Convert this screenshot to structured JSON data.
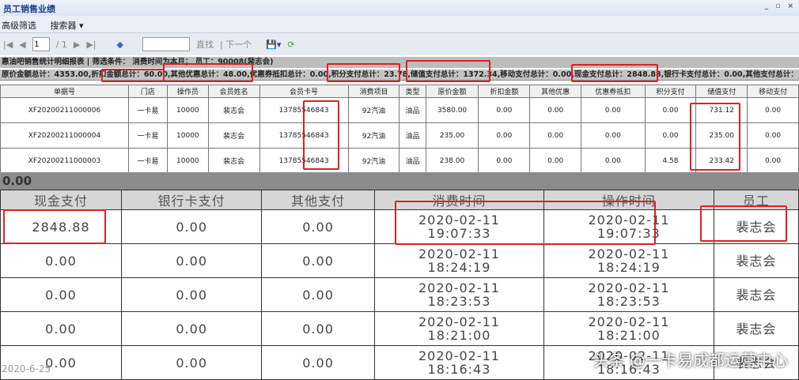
{
  "window": {
    "title": "员工销售业绩",
    "controls": "_ ▫ ×"
  },
  "menu": {
    "advanced_filter": "高级筛选",
    "searcher": "搜索器 ▾"
  },
  "nav": {
    "page": "1",
    "page_total": "/ 1",
    "find": "直找",
    "next": "| 下一个"
  },
  "info": {
    "line1": "惠油吧销售统计明细报表 | 筛选条件： 消费时间为本月； 员工：90008(裴志会)",
    "line2": "原价金额总计：4353.00,折扣金额总计：60.00,其他优惠总计：48.00,优惠券抵扣总计：0.00,积分支付总计：23.78,储值支付总计：1372.34,移动支付总计：0.00,现金支付总计：2848.88,银行卡支付总计：0.00,其他支付总计："
  },
  "table1": {
    "headers": [
      "单据号",
      "门店",
      "操作员",
      "会员姓名",
      "会员卡号",
      "消费项目",
      "类型",
      "原价金额",
      "折扣金额",
      "其他优惠",
      "优惠券抵扣",
      "积分支付",
      "储值支付",
      "移动支付"
    ],
    "rows": [
      [
        "XF20200211000006",
        "一卡易",
        "10000",
        "裴志会",
        "13785546843",
        "92汽油",
        "油品",
        "3580.00",
        "0.00",
        "0.00",
        "0.00",
        "0.00",
        "731.12",
        "0.00"
      ],
      [
        "XF20200211000004",
        "一卡易",
        "10000",
        "裴志会",
        "13785546843",
        "92汽油",
        "油品",
        "235.00",
        "0.00",
        "0.00",
        "0.00",
        "0.00",
        "235.00",
        "0.00"
      ],
      [
        "XF20200211000003",
        "一卡易",
        "10000",
        "裴志会",
        "13785546843",
        "92汽油",
        "油品",
        "238.00",
        "0.00",
        "0.00",
        "0.00",
        "4.58",
        "233.42",
        "0.00"
      ]
    ]
  },
  "band_value": "0.00",
  "table2": {
    "headers": [
      "现金支付",
      "银行卡支付",
      "其他支付",
      "消费时间",
      "操作时间",
      "员工"
    ],
    "rows": [
      [
        "2848.88",
        "0.00",
        "0.00",
        "2020-02-11\n19:07:33",
        "2020-02-11\n19:07:33",
        "裴志会"
      ],
      [
        "0.00",
        "0.00",
        "0.00",
        "2020-02-11\n18:24:19",
        "2020-02-11\n18:24:19",
        "裴志会"
      ],
      [
        "0.00",
        "0.00",
        "0.00",
        "2020-02-11\n18:23:53",
        "2020-02-11\n18:23:53",
        "裴志会"
      ],
      [
        "0.00",
        "0.00",
        "0.00",
        "2020-02-11\n18:21:00",
        "2020-02-11\n18:21:00",
        "裴志会"
      ],
      [
        "0.00",
        "0.00",
        "0.00",
        "2020-02-11\n18:16:43",
        "2020-02-11\n18:16:43",
        "裴志会"
      ]
    ]
  },
  "watermark": "头条 @一卡易成都运营中心",
  "date_stamp": "2020-6-25"
}
